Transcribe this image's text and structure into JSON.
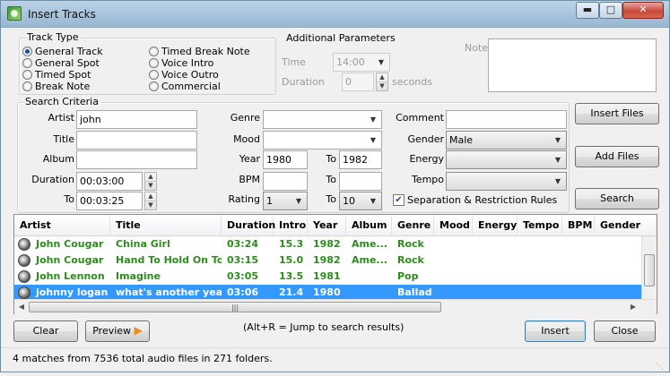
{
  "window": {
    "title": "Insert Tracks"
  },
  "track_type": {
    "label": "Track Type",
    "options": [
      "General Track",
      "General Spot",
      "Timed Spot",
      "Break Note",
      "Timed Break Note",
      "Voice Intro",
      "Voice Outro",
      "Commercial"
    ],
    "selected": "General Track"
  },
  "additional": {
    "label": "Additional Parameters",
    "time_label": "Time",
    "time_value": "14:00",
    "duration_label": "Duration",
    "duration_value": "0",
    "seconds_label": "seconds",
    "note_label": "Note",
    "note_value": ""
  },
  "search": {
    "label": "Search Criteria",
    "artist_label": "Artist",
    "artist_value": "john",
    "title_label": "Title",
    "title_value": "",
    "album_label": "Album",
    "album_value": "",
    "duration_label": "Duration",
    "duration_from": "00:03:00",
    "to_label": "To",
    "duration_to": "00:03:25",
    "genre_label": "Genre",
    "genre_value": "",
    "mood_label": "Mood",
    "mood_value": "",
    "year_label": "Year",
    "year_from": "1980",
    "year_to": "1982",
    "bpm_label": "BPM",
    "bpm_from": "",
    "bpm_to": "",
    "rating_label": "Rating",
    "rating_from": "1",
    "rating_to": "10",
    "comment_label": "Comment",
    "comment_value": "",
    "gender_label": "Gender",
    "gender_value": "Male",
    "energy_label": "Energy",
    "energy_value": "",
    "tempo_label": "Tempo",
    "tempo_value": "",
    "separation_label": "Separation & Restriction Rules",
    "separation_checked": true
  },
  "buttons": {
    "insert_files": "Insert Files",
    "add_files": "Add Files",
    "search": "Search",
    "clear": "Clear",
    "preview": "Preview",
    "insert": "Insert",
    "close": "Close"
  },
  "results": {
    "columns": [
      "Artist",
      "Title",
      "Duration",
      "Intro",
      "Year",
      "Album",
      "Genre",
      "Mood",
      "Energy",
      "Tempo",
      "BPM",
      "Gender"
    ],
    "rows": [
      {
        "artist": "John Cougar",
        "title": "China Girl",
        "duration": "03:24",
        "intro": "15.3",
        "year": "1982",
        "album": "Ame...",
        "genre": "Rock"
      },
      {
        "artist": "John Cougar",
        "title": "Hand To Hold On To",
        "duration": "03:15",
        "intro": "15.0",
        "year": "1982",
        "album": "Ame...",
        "genre": "Rock"
      },
      {
        "artist": "John Lennon",
        "title": "Imagine",
        "duration": "03:05",
        "intro": "13.5",
        "year": "1981",
        "album": "",
        "genre": "Pop"
      },
      {
        "artist": "johnny logan",
        "title": "what's another year",
        "duration": "03:06",
        "intro": "21.4",
        "year": "1980",
        "album": "",
        "genre": "Ballad"
      }
    ],
    "selected_index": 3
  },
  "hint": "(Alt+R = Jump to search results)",
  "status": "4 matches from 7536 total audio files in 271 folders.",
  "colors": {
    "match_text": "#2e8b1e",
    "selection": "#3399ff"
  }
}
